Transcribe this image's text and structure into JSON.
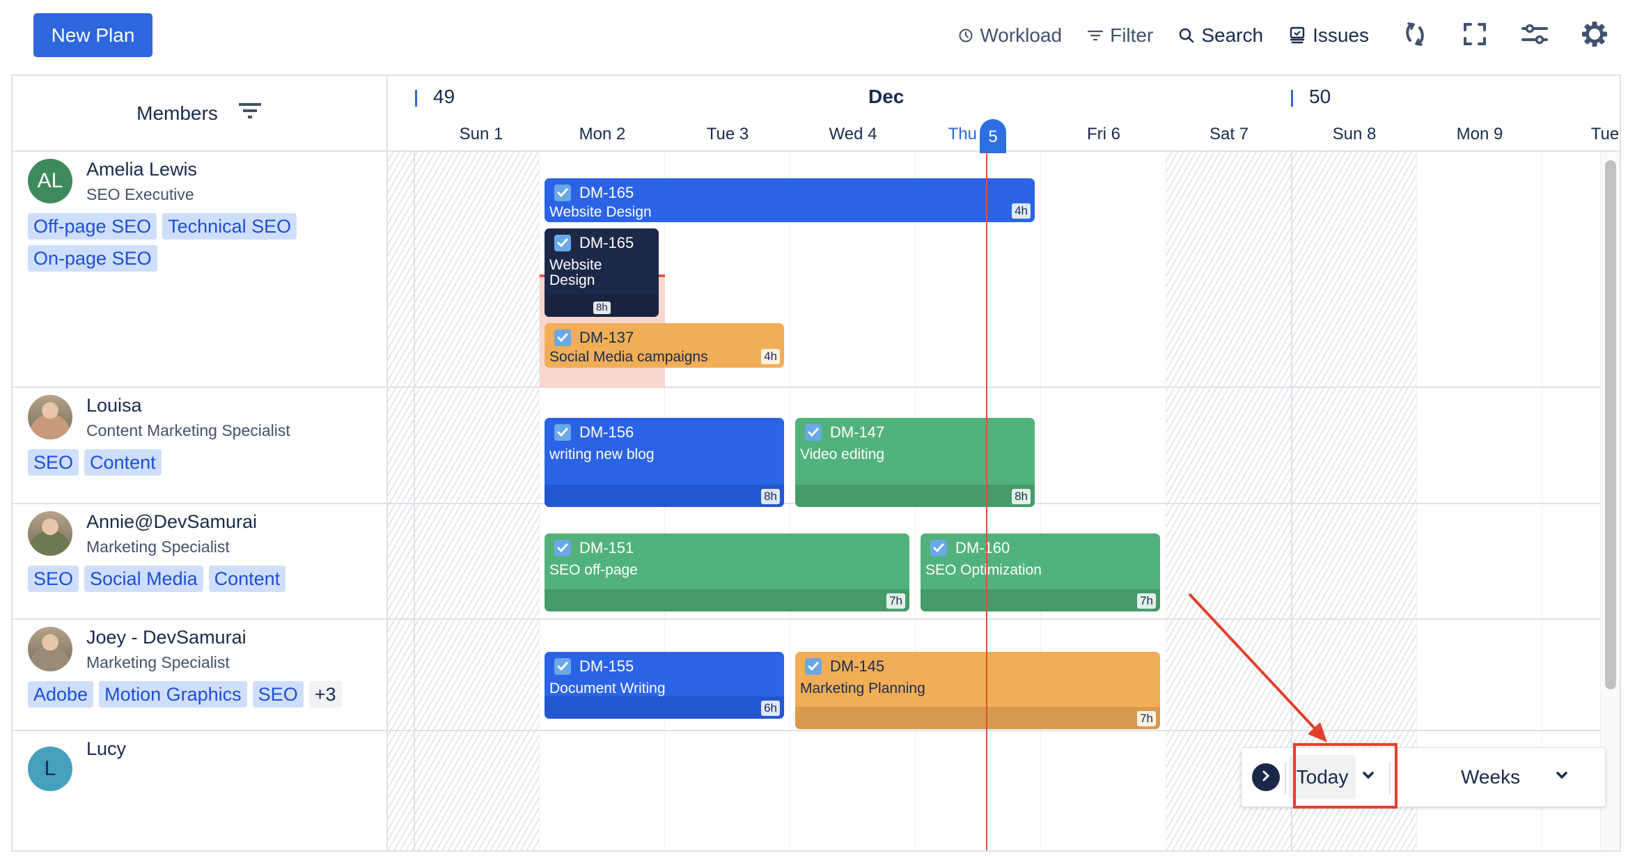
{
  "toolbar": {
    "new_plan_label": "New Plan",
    "workload_label": "Workload",
    "filter_label": "Filter",
    "search_label": "Search",
    "issues_label": "Issues",
    "icons": [
      "clock-icon",
      "filter-icon",
      "search-icon",
      "issues-icon",
      "sync-icon",
      "fullscreen-icon",
      "sliders-icon",
      "gear-icon"
    ]
  },
  "members_header": {
    "title": "Members",
    "icon": "sort-filter-icon"
  },
  "calendar": {
    "month": "Dec",
    "weeks": [
      "49",
      "50"
    ],
    "days": [
      {
        "label": "Sun 1",
        "weekend": true
      },
      {
        "label": "Mon 2",
        "weekend": false
      },
      {
        "label": "Tue 3",
        "weekend": false
      },
      {
        "label": "Wed 4",
        "weekend": false
      },
      {
        "label": "Thu",
        "today_number": "5",
        "weekend": false,
        "today": true
      },
      {
        "label": "Fri 6",
        "weekend": false
      },
      {
        "label": "Sat 7",
        "weekend": true
      },
      {
        "label": "Sun 8",
        "weekend": true
      },
      {
        "label": "Mon 9",
        "weekend": false
      },
      {
        "label": "Tue",
        "weekend": false
      }
    ]
  },
  "members": [
    {
      "name": "Amelia Lewis",
      "role": "SEO Executive",
      "avatar_initials": "AL",
      "avatar_color": "#3e8a5c",
      "tags": [
        "Off-page SEO",
        "Technical SEO",
        "On-page SEO"
      ],
      "more": ""
    },
    {
      "name": "Louisa",
      "role": "Content Marketing Specialist",
      "avatar_initials": "",
      "avatar_color": "#c79a7c",
      "tags": [
        "SEO",
        "Content"
      ],
      "more": ""
    },
    {
      "name": "Annie@DevSamurai",
      "role": "Marketing Specialist",
      "avatar_initials": "",
      "avatar_color": "#6a7a52",
      "tags": [
        "SEO",
        "Social Media",
        "Content"
      ],
      "more": ""
    },
    {
      "name": "Joey - DevSamurai",
      "role": "Marketing Specialist",
      "avatar_initials": "",
      "avatar_color": "#9a8a76",
      "tags": [
        "Adobe",
        "Motion Graphics",
        "SEO"
      ],
      "more": "+3"
    },
    {
      "name": "Lucy",
      "role": "",
      "avatar_initials": "L",
      "avatar_color": "#45a0bd",
      "tags": [],
      "more": ""
    }
  ],
  "tasks": [
    {
      "key": "DM-165",
      "summary": "Website Design",
      "hours": "4h",
      "color": "blue",
      "member": 0
    },
    {
      "key": "DM-165",
      "summary": "Website Design",
      "hours": "8h",
      "color": "dark",
      "member": 0
    },
    {
      "key": "DM-137",
      "summary": "Social Media campaigns",
      "hours": "4h",
      "color": "orange",
      "member": 0
    },
    {
      "key": "DM-156",
      "summary": "writing new blog",
      "hours": "8h",
      "color": "blue",
      "member": 1
    },
    {
      "key": "DM-147",
      "summary": "Video editing",
      "hours": "8h",
      "color": "green",
      "member": 1
    },
    {
      "key": "DM-151",
      "summary": "SEO off-page",
      "hours": "7h",
      "color": "green",
      "member": 2
    },
    {
      "key": "DM-160",
      "summary": "SEO Optimization",
      "hours": "7h",
      "color": "green",
      "member": 2
    },
    {
      "key": "DM-155",
      "summary": "Document Writing",
      "hours": "6h",
      "color": "blue",
      "member": 3
    },
    {
      "key": "DM-145",
      "summary": "Marketing Planning",
      "hours": "7h",
      "color": "orange",
      "member": 3
    }
  ],
  "controls": {
    "today_label": "Today",
    "view_label": "Weeks"
  },
  "colors": {
    "accent": "#2d66dd",
    "today_line": "#d9503f",
    "annotation": "#e2402d"
  }
}
